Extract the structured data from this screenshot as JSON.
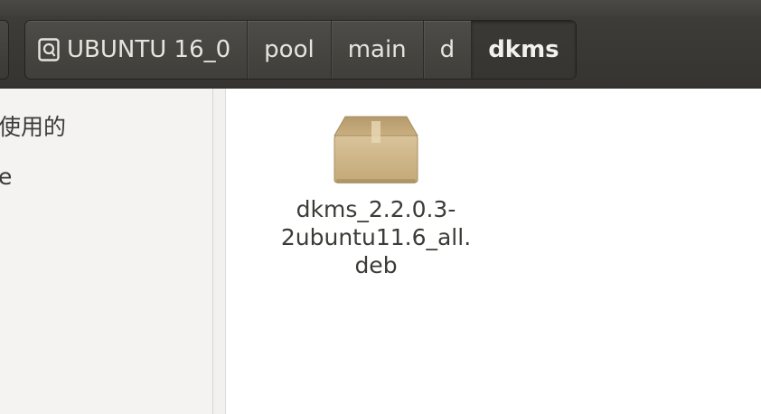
{
  "pathbar": {
    "crumbs": [
      {
        "label": "UBUNTU 16_0",
        "icon": "drive-icon"
      },
      {
        "label": "pool"
      },
      {
        "label": "main"
      },
      {
        "label": "d"
      },
      {
        "label": "dkms",
        "active": true
      }
    ]
  },
  "sidebar": {
    "items": [
      {
        "label": "使用的"
      },
      {
        "label": "e"
      }
    ]
  },
  "files": [
    {
      "name_lines": [
        "dkms_2.2.0.3-",
        "2ubuntu11.6_all.",
        "deb"
      ],
      "icon": "package-icon"
    }
  ],
  "colors": {
    "toolbar": "#3b3a36",
    "sidebar": "#f4f3f2",
    "text": "#3c3b37",
    "crumb_text": "#e6e4dd"
  }
}
